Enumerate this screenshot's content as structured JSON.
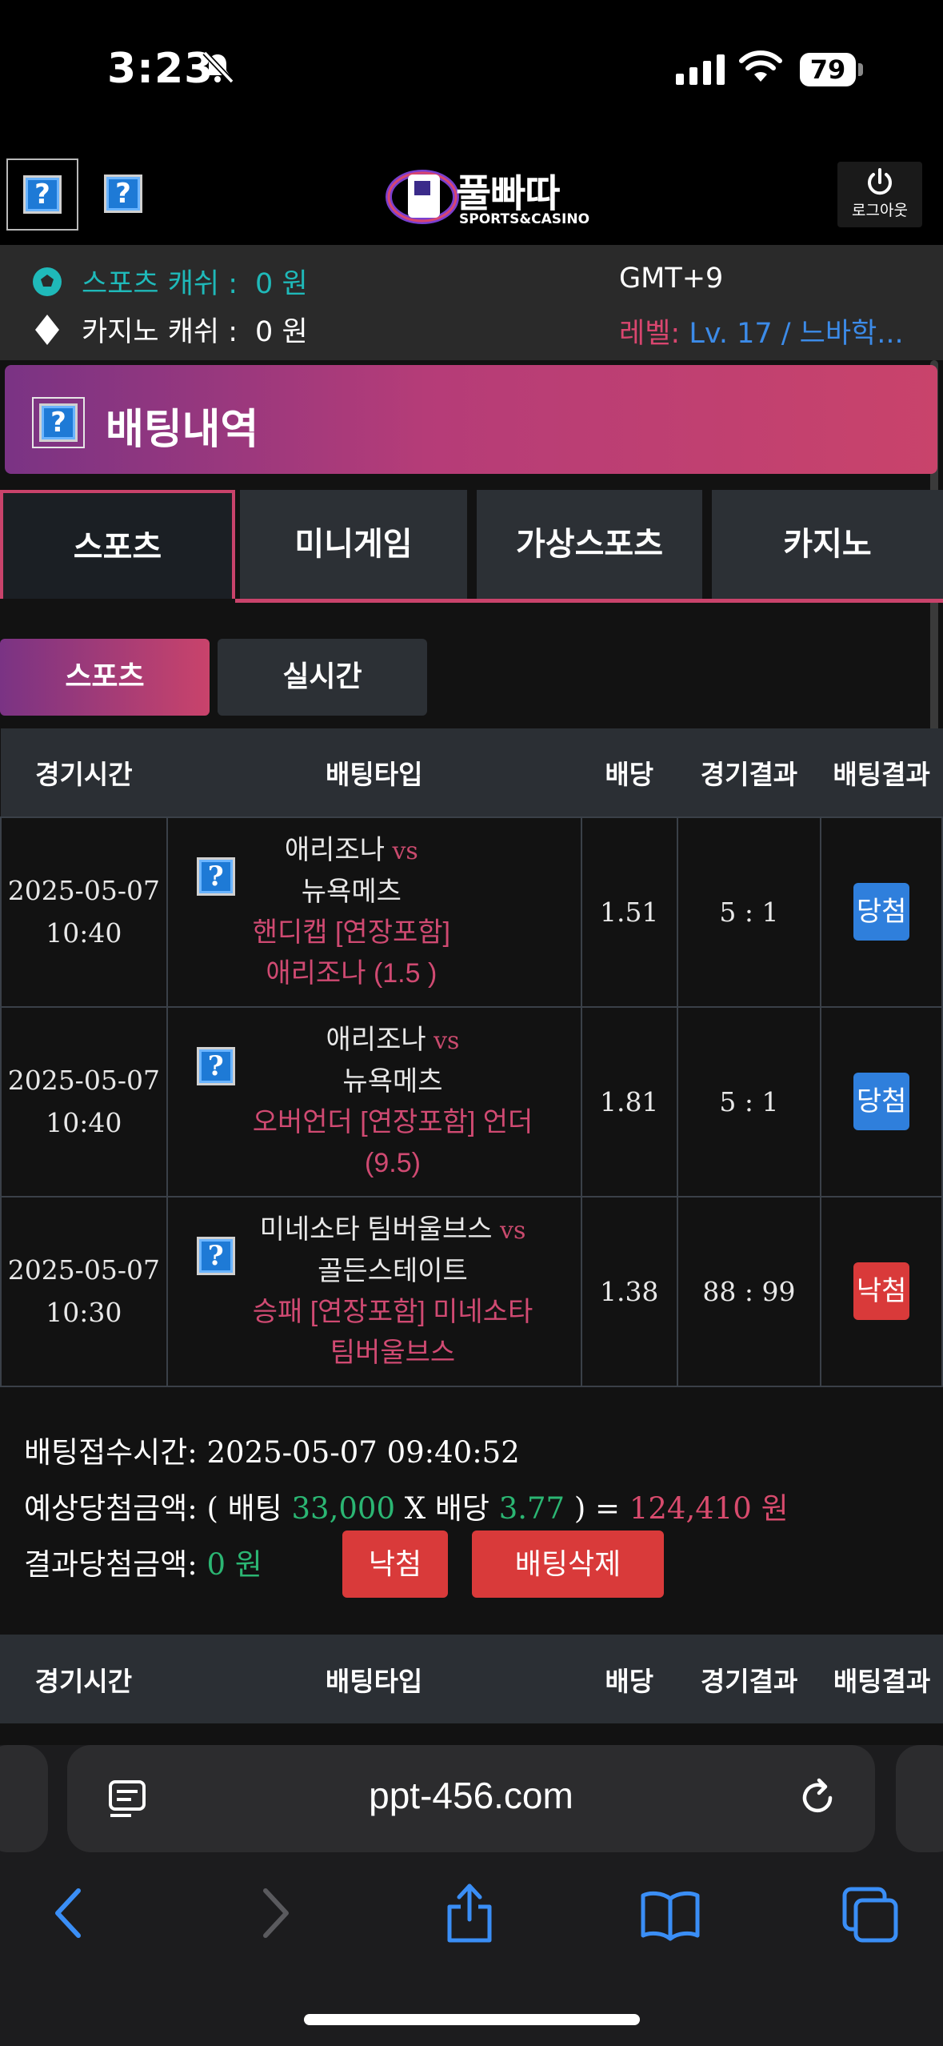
{
  "status": {
    "time": "3:23",
    "battery": "79"
  },
  "header": {
    "logo_text": "풀빠따",
    "logo_sub": "SPORTS&CASINO",
    "logout_label": "로그아웃",
    "icon_placeholder": "?"
  },
  "account": {
    "sports_cash_label": "스포츠 캐쉬 :",
    "sports_cash_value": "0 원",
    "casino_cash_label": "카지노 캐쉬 :",
    "casino_cash_value": "0 원",
    "timezone": "GMT+9",
    "level_label": "레벨:",
    "level_value": "Lv. 17 / 느바학..."
  },
  "page": {
    "title": "배팅내역"
  },
  "tabs": [
    {
      "label": "스포츠",
      "active": true
    },
    {
      "label": "미니게임",
      "active": false
    },
    {
      "label": "가상스포츠",
      "active": false
    },
    {
      "label": "카지노",
      "active": false
    }
  ],
  "subtabs": [
    {
      "label": "스포츠",
      "active": true
    },
    {
      "label": "실시간",
      "active": false
    }
  ],
  "table": {
    "headers": [
      "경기시간",
      "배팅타입",
      "배당",
      "경기결과",
      "배팅결과"
    ],
    "rows": [
      {
        "date": "2025-05-07",
        "time": "10:40",
        "home": "애리조나",
        "vs": "vs",
        "away": "뉴욕메츠",
        "type_line1": "핸디캡 [연장포함]",
        "type_line2": "애리조나 (1.5 )",
        "odds": "1.51",
        "score": "5 : 1",
        "result": "당첨",
        "result_kind": "win"
      },
      {
        "date": "2025-05-07",
        "time": "10:40",
        "home": "애리조나",
        "vs": "vs",
        "away": "뉴욕메츠",
        "type_line1": "오버언더 [연장포함] 언더",
        "type_line2": "(9.5)",
        "odds": "1.81",
        "score": "5 : 1",
        "result": "당첨",
        "result_kind": "win"
      },
      {
        "date": "2025-05-07",
        "time": "10:30",
        "home": "미네소타 팀버울브스",
        "vs": "vs",
        "away": "골든스테이트",
        "type_line1": "승패 [연장포함] 미네소타",
        "type_line2": "팀버울브스",
        "odds": "1.38",
        "score": "88 : 99",
        "result": "낙첨",
        "result_kind": "lose"
      }
    ]
  },
  "summary": {
    "received_label": "배팅접수시간:",
    "received_value": "2025-05-07 09:40:52",
    "expected_label": "예상당첨금액: ( 배팅",
    "bet_amount": "33,000",
    "x_label": "X 배당",
    "total_odds": "3.77",
    "paren_eq": ") =",
    "expected_win": "124,410 원",
    "result_label": "결과당첨금액:",
    "result_value": "0 원",
    "lose_button": "낙첨",
    "delete_button": "배팅삭제"
  },
  "browser": {
    "url": "ppt-456.com"
  },
  "colors": {
    "accent_pink": "#c9436b",
    "accent_purple": "#7a3384",
    "win_blue": "#2f7fdc",
    "lose_red": "#d93a3a",
    "cash_teal": "#1fb9b9",
    "green": "#2bb673"
  }
}
